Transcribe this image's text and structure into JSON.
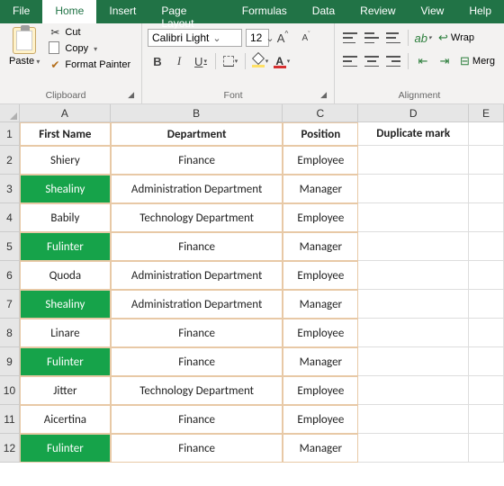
{
  "menu": [
    "File",
    "Home",
    "Insert",
    "Page Layout",
    "Formulas",
    "Data",
    "Review",
    "View",
    "Help"
  ],
  "active_tab": "Home",
  "clipboard": {
    "paste": "Paste",
    "cut": "Cut",
    "copy": "Copy",
    "format_painter": "Format Painter",
    "group_label": "Clipboard"
  },
  "font": {
    "name": "Calibri Light",
    "size": "12",
    "grow_label": "A",
    "shrink_label": "A",
    "bold": "B",
    "italic": "I",
    "underline": "U",
    "fontcolor_letter": "A",
    "group_label": "Font"
  },
  "alignment": {
    "wrap": "Wrap",
    "merge": "Merg",
    "group_label": "Alignment"
  },
  "columns": [
    "A",
    "B",
    "C",
    "D",
    "E"
  ],
  "rows": [
    "1",
    "2",
    "3",
    "4",
    "5",
    "6",
    "7",
    "8",
    "9",
    "10",
    "11",
    "12"
  ],
  "headers": [
    "First Name",
    "Department",
    "Position",
    "Duplicate mark"
  ],
  "data": [
    {
      "first": "Shiery",
      "dept": "Finance",
      "pos": "Employee",
      "hl": false
    },
    {
      "first": "Shealiny",
      "dept": "Administration Department",
      "pos": "Manager",
      "hl": true
    },
    {
      "first": "Babily",
      "dept": "Technology Department",
      "pos": "Employee",
      "hl": false
    },
    {
      "first": "Fulinter",
      "dept": "Finance",
      "pos": "Manager",
      "hl": true
    },
    {
      "first": "Quoda",
      "dept": "Administration Department",
      "pos": "Employee",
      "hl": false
    },
    {
      "first": "Shealiny",
      "dept": "Administration Department",
      "pos": "Manager",
      "hl": true
    },
    {
      "first": "Linare",
      "dept": "Finance",
      "pos": "Employee",
      "hl": false
    },
    {
      "first": "Fulinter",
      "dept": "Finance",
      "pos": "Manager",
      "hl": true
    },
    {
      "first": "Jitter",
      "dept": "Technology Department",
      "pos": "Employee",
      "hl": false
    },
    {
      "first": "Aicertina",
      "dept": "Finance",
      "pos": "Employee",
      "hl": false
    },
    {
      "first": "Fulinter",
      "dept": "Finance",
      "pos": "Manager",
      "hl": true
    }
  ],
  "highlight_color": "#16a34a"
}
